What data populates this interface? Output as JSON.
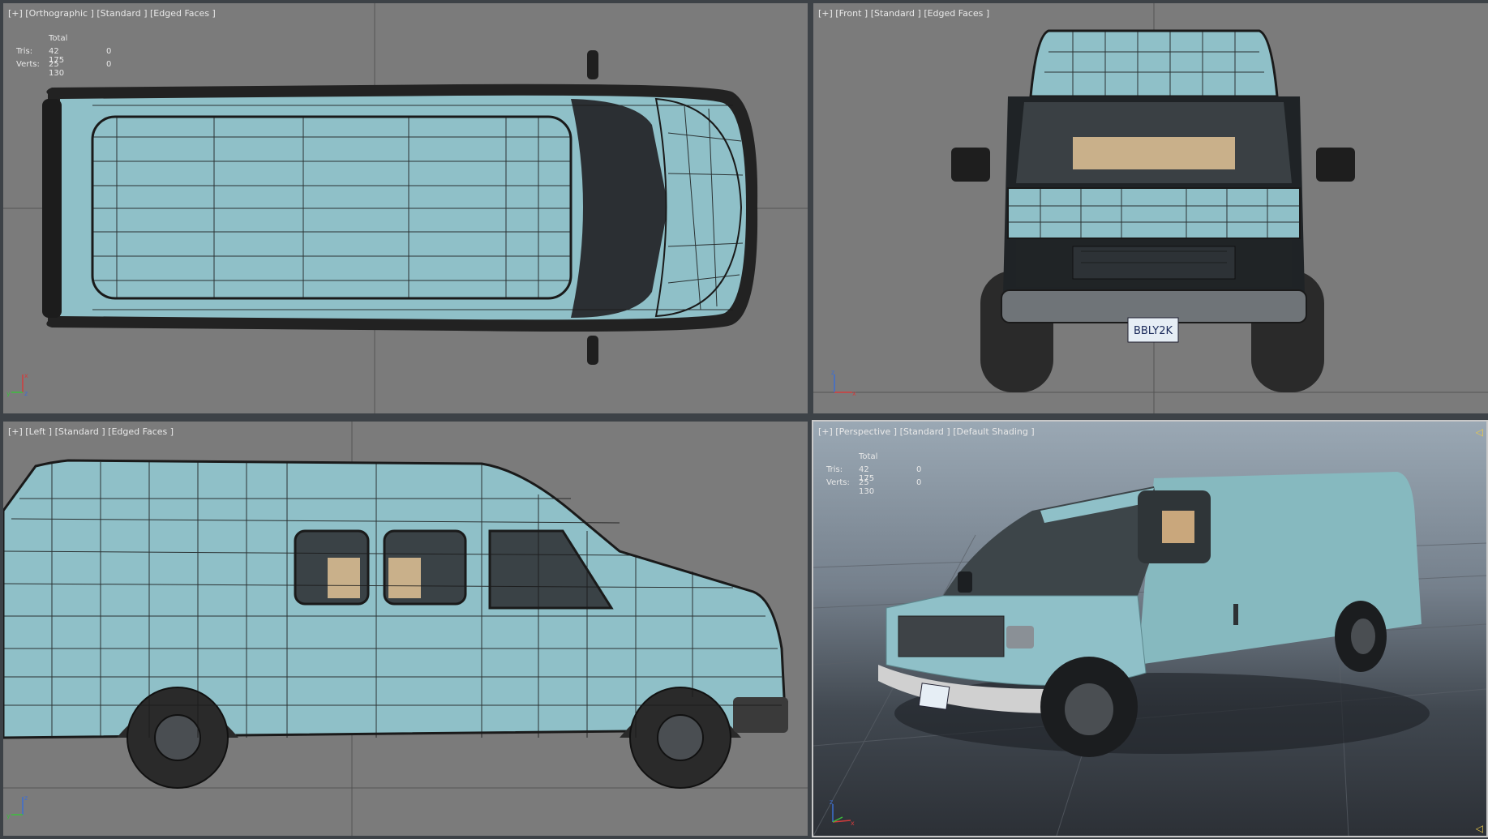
{
  "viewports": {
    "top": {
      "label": "[+] [Orthographic ] [Standard ] [Edged Faces ]"
    },
    "front": {
      "label": "[+] [Front ] [Standard ] [Edged Faces ]"
    },
    "left": {
      "label": "[+] [Left ] [Standard ] [Edged Faces ]"
    },
    "perspective": {
      "label": "[+] [Perspective ] [Standard ] [Default Shading ]"
    }
  },
  "stats": {
    "total_header": "Total",
    "tris_label": "Tris:",
    "tris_value": "42 175",
    "tris_sel": "0",
    "verts_label": "Verts:",
    "verts_value": "25 130",
    "verts_sel": "0"
  },
  "plate_text": "BBLY2K",
  "colors": {
    "viewport_bg": "#7b7b7b",
    "van_body": "#8fc0c8",
    "wire": "#1a1a1a",
    "axis_x": "#d23c3c",
    "axis_y": "#3cbf3c",
    "axis_z": "#3c6ed2"
  }
}
